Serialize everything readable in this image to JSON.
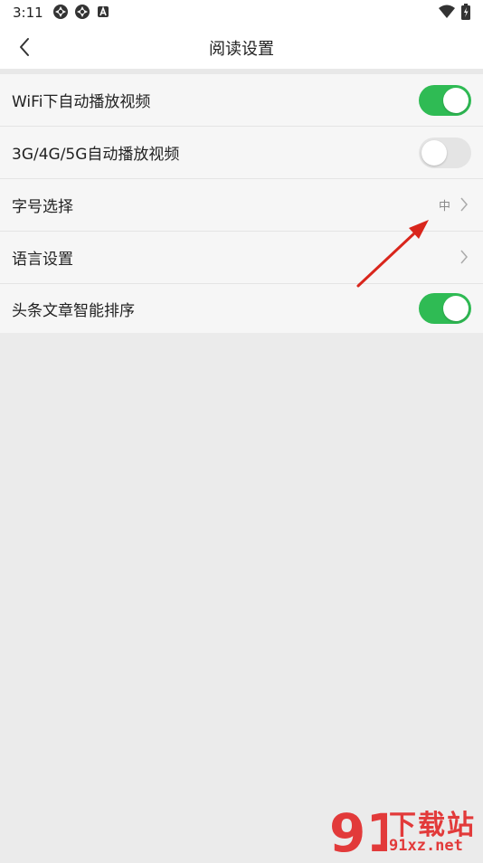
{
  "status_bar": {
    "time": "3:11",
    "left_icons": [
      "shutter-icon",
      "shutter-icon",
      "a-badge-icon"
    ],
    "right_icons": [
      "wifi-icon",
      "battery-charging-icon"
    ]
  },
  "header": {
    "title": "阅读设置",
    "back_icon": "chevron-left-icon"
  },
  "settings": {
    "items": [
      {
        "label": "WiFi下自动播放视频",
        "type": "toggle",
        "on": true
      },
      {
        "label": "3G/4G/5G自动播放视频",
        "type": "toggle",
        "on": false
      },
      {
        "label": "字号选择",
        "type": "nav",
        "value": "中"
      },
      {
        "label": "语言设置",
        "type": "nav",
        "value": ""
      },
      {
        "label": "头条文章智能排序",
        "type": "toggle",
        "on": true
      }
    ]
  },
  "colors": {
    "toggle_on": "#2fbb54",
    "toggle_off": "#e4e4e4",
    "annotation_arrow": "#d9261c",
    "watermark": "#e23a3a"
  },
  "watermark": {
    "logo_text": "91",
    "line1": "下载站",
    "line2": "91xz.net"
  }
}
